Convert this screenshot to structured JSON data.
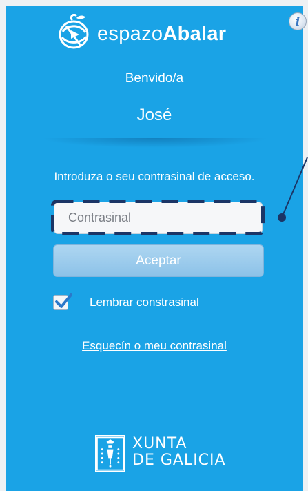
{
  "app": {
    "logo_prefix": "espazo",
    "logo_suffix": "Abalar",
    "info_glyph": "i",
    "info_icon": "info-icon",
    "brand_color": "#1aa3e6"
  },
  "greeting": {
    "welcome": "Benvido/a",
    "username": "José"
  },
  "login": {
    "instructions": "Introduza o seu contrasinal de acceso.",
    "password_placeholder": "Contrasinal",
    "password_value": "",
    "accept_label": "Aceptar",
    "remember_label": "Lembrar constrasinal",
    "remember_checked": true,
    "forgot_link": "Esquecín o meu contrasinal"
  },
  "footer": {
    "org_line1": "XUNTA",
    "org_line2": "DE GALICIA"
  }
}
